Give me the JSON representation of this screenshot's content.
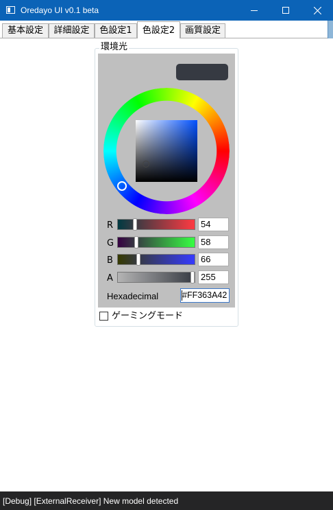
{
  "window": {
    "title": "Oredayo UI v0.1 beta",
    "icons": [
      "app-window-icon",
      "minimize-icon",
      "maximize-icon",
      "close-icon"
    ]
  },
  "tabs": [
    {
      "label": "基本設定",
      "active": false
    },
    {
      "label": "詳細設定",
      "active": false
    },
    {
      "label": "色設定1",
      "active": false
    },
    {
      "label": "色設定2",
      "active": true
    },
    {
      "label": "画質設定",
      "active": false
    }
  ],
  "color_group": {
    "title": "環境光",
    "preview_color": "#363A42",
    "channels": [
      {
        "label": "R",
        "value": "54",
        "fraction": 0.212,
        "from": "#003A42",
        "to": "#FF3A42"
      },
      {
        "label": "G",
        "value": "58",
        "fraction": 0.227,
        "from": "#360042",
        "to": "#36FF42"
      },
      {
        "label": "B",
        "value": "66",
        "fraction": 0.259,
        "from": "#363A00",
        "to": "#363AFF"
      },
      {
        "label": "A",
        "value": "255",
        "fraction": 1.0,
        "from": "#B4B4B4",
        "to": "#363A42"
      }
    ],
    "hex_label": "Hexadecimal",
    "hex_value": "#FF363A42"
  },
  "gaming_mode": {
    "label": "ゲーミングモード",
    "checked": false
  },
  "status_bar": {
    "text": "[Debug] [ExternalReceiver] New model detected"
  }
}
